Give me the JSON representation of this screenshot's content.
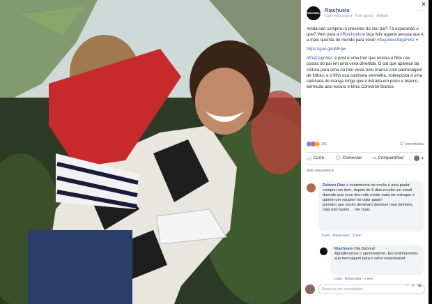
{
  "page": {
    "name": "Riachuelo",
    "meta": "Curtir esta página · 8 de agosto · Editado ·",
    "logo_text": "RIACHUELO"
  },
  "post": {
    "p1": "Ainda não comprou o presente do seu pai? Tá esperando o que? Vem para a ",
    "p1_tag": "#Riachuelo",
    "p1_b": " e faça feliz aquela pessoa que é a mais querida do mundo para você! ",
    "p1_tag2": "#SejaVoceSejaFeliz",
    "link": "https://goo.gl/uMFpw",
    "p3_tag": "#PraCegoVer",
    "p3": ": é post é uma foto que mostra o filho nas costas do pai em uma cena divertida. O pai que aparece da cintura para cima na foto veste polo branca com padronagem de folhas, e o filho usa camiseta vermelha, sobreposta a uma camiseta de manga longa que é listrada em preto e branco, bermuda azul escuro e tênis Converse branco."
  },
  "reactions": {
    "count": "141",
    "comments": "17 comentários"
  },
  "actions": {
    "like": "Curtir",
    "comment": "Comentar",
    "share": "Compartilhar"
  },
  "relevance": "Mais relevantes ▾",
  "comments": [
    {
      "author": "Debora Dias",
      "text": "o ecommerce de vocês é uma piada!\ncomprei um item, depois de 5 dias recebo um email dizendo que esse item não existe mais em estoque e ganhei um voucher no valor gasto!\nprimeiro que vocês deveriam devolver meu dinheiro, mas não fazem ... Ver mais",
      "actions": "Curtir · Responder · 2 sem"
    },
    {
      "author": "Riachuelo",
      "text": "Olá Debora!\nAgradecemos o apontamento. Encaminharemos sua mensagem para o setor responsável.",
      "actions": "Curtir · Responder · 2 sem"
    }
  ],
  "write": {
    "placeholder": "Escreva um comentário..."
  },
  "icons": {
    "more": "more-icon",
    "close": "close-icon",
    "like": "thumbs-up-icon",
    "comment": "comment-icon",
    "share": "share-icon"
  },
  "colors": {
    "link": "#385898",
    "like": "#5890ff",
    "love": "#f25268",
    "wow": "#f7b125"
  }
}
